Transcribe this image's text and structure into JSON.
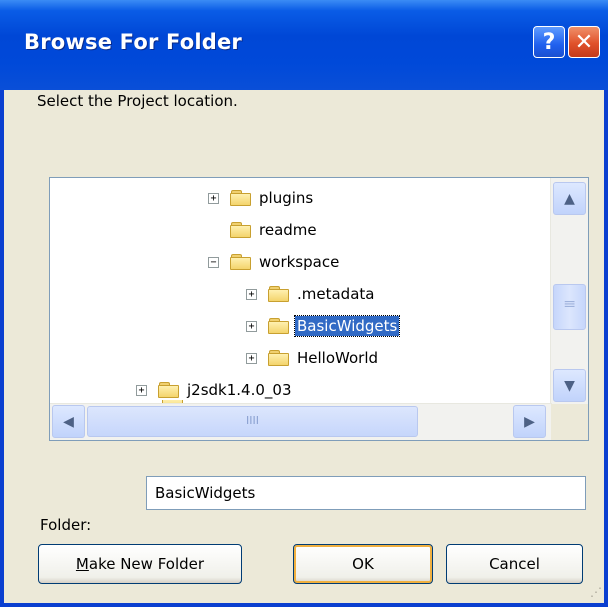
{
  "window": {
    "title": "Browse For Folder",
    "help_glyph": "?",
    "close_glyph": "✕"
  },
  "prompt": "Select the Project location.",
  "tree": {
    "items": [
      {
        "label": "plugins",
        "expander": "+",
        "indent": 1
      },
      {
        "label": "readme",
        "expander": "",
        "indent": 1
      },
      {
        "label": "workspace",
        "expander": "−",
        "indent": 1
      },
      {
        "label": ".metadata",
        "expander": "+",
        "indent": 2
      },
      {
        "label": "BasicWidgets",
        "expander": "+",
        "indent": 2,
        "selected": true
      },
      {
        "label": "HelloWorld",
        "expander": "+",
        "indent": 2
      },
      {
        "label": "j2sdk1.4.0_03",
        "expander": "+",
        "indent": 0
      }
    ]
  },
  "scroll": {
    "up": "▲",
    "down": "▼",
    "left": "◀",
    "right": "▶",
    "grip": "|||",
    "hgrip": "IIII"
  },
  "folder_field": {
    "label": "Folder:",
    "value": "BasicWidgets"
  },
  "buttons": {
    "make_new_folder": "Make New Folder",
    "ok": "OK",
    "cancel": "Cancel"
  },
  "colors": {
    "titlebar": "#0047d6",
    "selection": "#316ac5",
    "dialog_bg": "#ece9d8"
  }
}
